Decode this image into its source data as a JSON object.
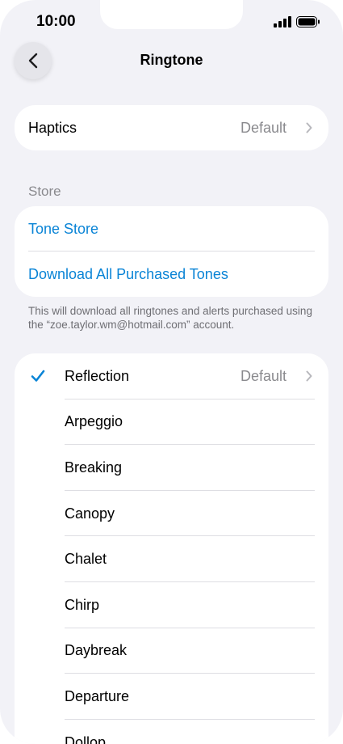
{
  "status_bar": {
    "time": "10:00"
  },
  "nav": {
    "title": "Ringtone"
  },
  "haptics": {
    "label": "Haptics",
    "value": "Default"
  },
  "store_section": {
    "header": "Store",
    "items": [
      {
        "label": "Tone Store"
      },
      {
        "label": "Download All Purchased Tones"
      }
    ],
    "footnote": "This will download all ringtones and alerts purchased using the “zoe.taylor.wm@hotmail.com” account."
  },
  "ringtones": {
    "selected_value": "Default",
    "items": [
      {
        "label": "Reflection",
        "selected": true
      },
      {
        "label": "Arpeggio"
      },
      {
        "label": "Breaking"
      },
      {
        "label": "Canopy"
      },
      {
        "label": "Chalet"
      },
      {
        "label": "Chirp"
      },
      {
        "label": "Daybreak"
      },
      {
        "label": "Departure"
      },
      {
        "label": "Dollop"
      }
    ]
  },
  "colors": {
    "accent": "#0a84d6",
    "background": "#f2f2f7",
    "secondary_text": "#8a8a8e"
  }
}
